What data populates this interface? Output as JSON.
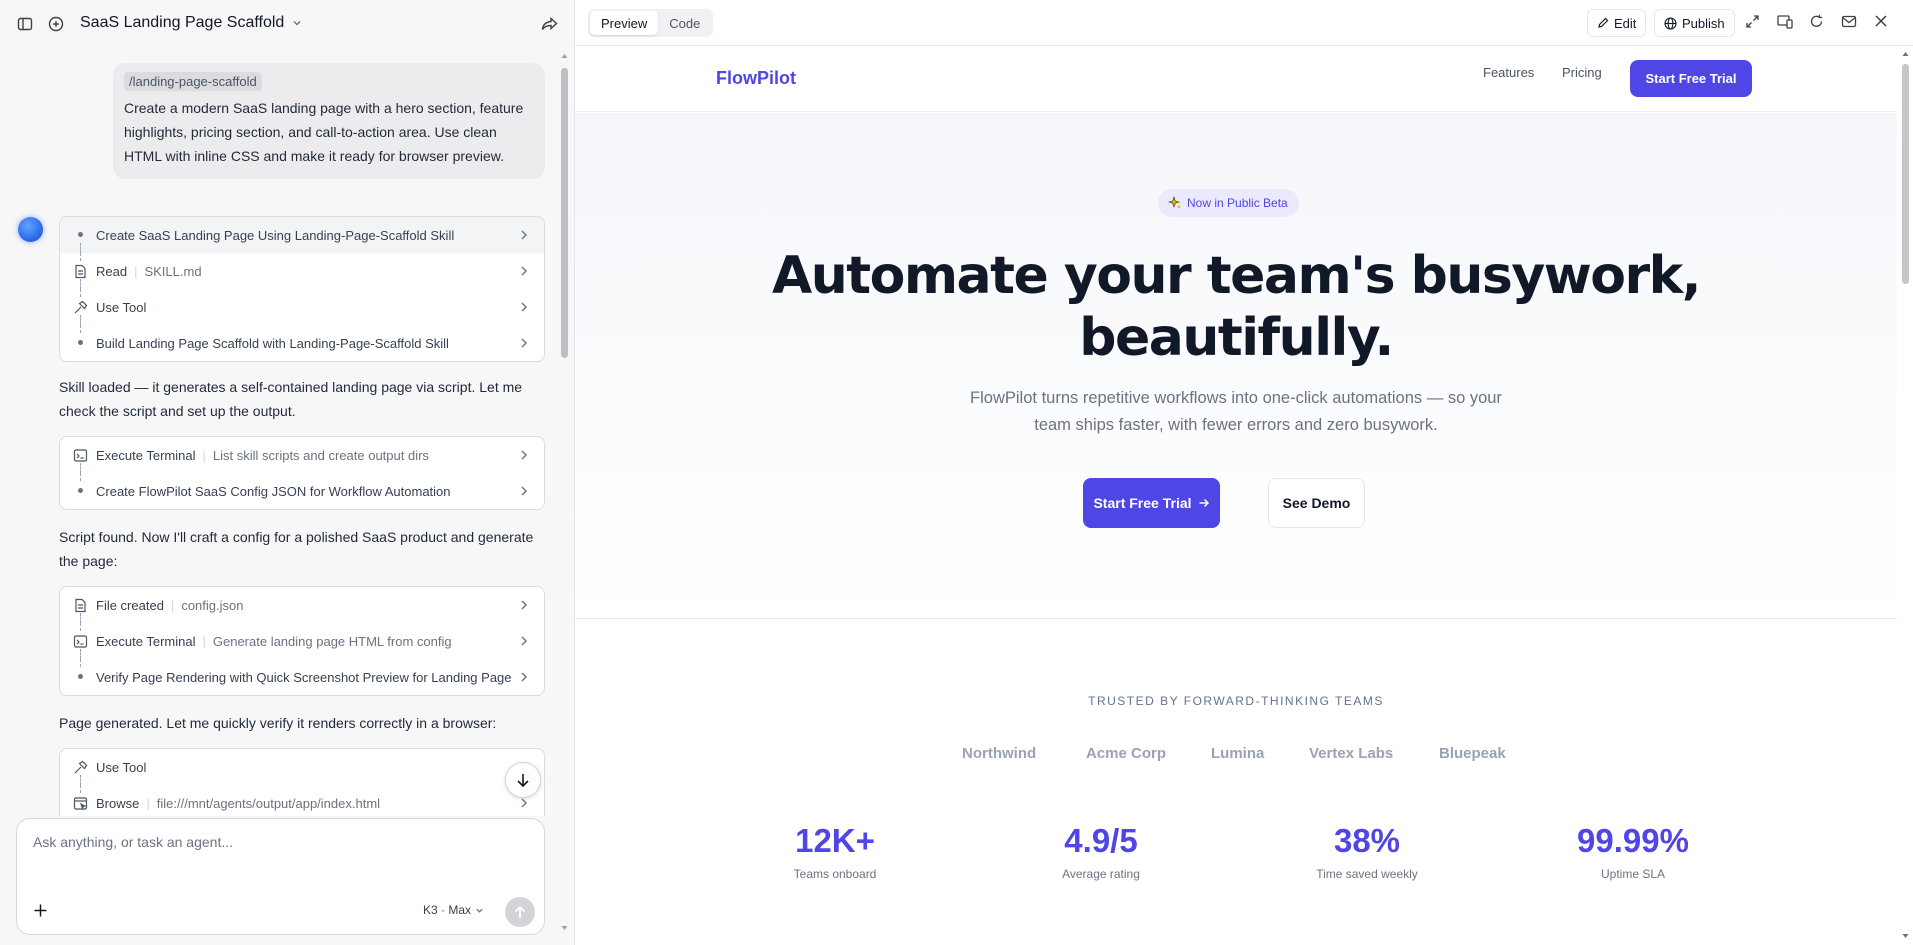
{
  "chat": {
    "title": "SaaS Landing Page Scaffold",
    "user_command": "/landing-page-scaffold",
    "user_text": "Create a modern SaaS landing page with a hero section, feature highlights, pricing section, and call-to-action area. Use clean HTML with inline CSS and make it ready for browser preview.",
    "group1": [
      {
        "label": "Create SaaS Landing Page Using Landing-Page-Scaffold Skill"
      },
      {
        "label": "Read",
        "detail": "SKILL.md"
      },
      {
        "label": "Use Tool"
      },
      {
        "label": "Build Landing Page Scaffold with Landing-Page-Scaffold Skill"
      }
    ],
    "msg1": "Skill loaded — it generates a self-contained landing page via script. Let me check the script and set up the output.",
    "group2": [
      {
        "label": "Execute Terminal",
        "detail": "List skill scripts and create output dirs"
      },
      {
        "label": "Create FlowPilot SaaS Config JSON for Workflow Automation"
      }
    ],
    "msg2": "Script found. Now I'll craft a config for a polished SaaS product and generate the page:",
    "group3": [
      {
        "label": "File created",
        "detail": "config.json"
      },
      {
        "label": "Execute Terminal",
        "detail": "Generate landing page HTML from config"
      },
      {
        "label": "Verify Page Rendering with Quick Screenshot Preview for Landing Page"
      }
    ],
    "msg3": "Page generated. Let me quickly verify it renders correctly in a browser:",
    "group4": [
      {
        "label": "Use Tool"
      },
      {
        "label": "Browse",
        "detail": "file:///mnt/agents/output/app/index.html"
      }
    ],
    "composer_placeholder": "Ask anything, or task an agent...",
    "model": "K3 · Max"
  },
  "preview": {
    "tabs": [
      "Preview",
      "Code"
    ],
    "edit_label": "Edit",
    "publish_label": "Publish"
  },
  "site": {
    "logo": "FlowPilot",
    "nav": [
      "Features",
      "Pricing"
    ],
    "nav_cta": "Start Free Trial",
    "badge": "Now in Public Beta",
    "headline_line1": "Automate your team's busywork,",
    "headline_line2": "beautifully.",
    "subtitle_line1": "FlowPilot turns repetitive workflows into one-click automations — so your",
    "subtitle_line2": "team ships faster, with fewer errors and zero busywork.",
    "cta_primary": "Start Free Trial",
    "cta_secondary": "See Demo",
    "trusted_label": "TRUSTED BY FORWARD-THINKING TEAMS",
    "brands": [
      "Northwind",
      "Acme Corp",
      "Lumina",
      "Vertex Labs",
      "Bluepeak"
    ],
    "stats": [
      {
        "value": "12K+",
        "label": "Teams onboard"
      },
      {
        "value": "4.9/5",
        "label": "Average rating"
      },
      {
        "value": "38%",
        "label": "Time saved weekly"
      },
      {
        "value": "99.99%",
        "label": "Uptime SLA"
      }
    ]
  },
  "colors": {
    "accent": "#4f46e5",
    "heading": "#111827",
    "muted": "#6b7280"
  }
}
